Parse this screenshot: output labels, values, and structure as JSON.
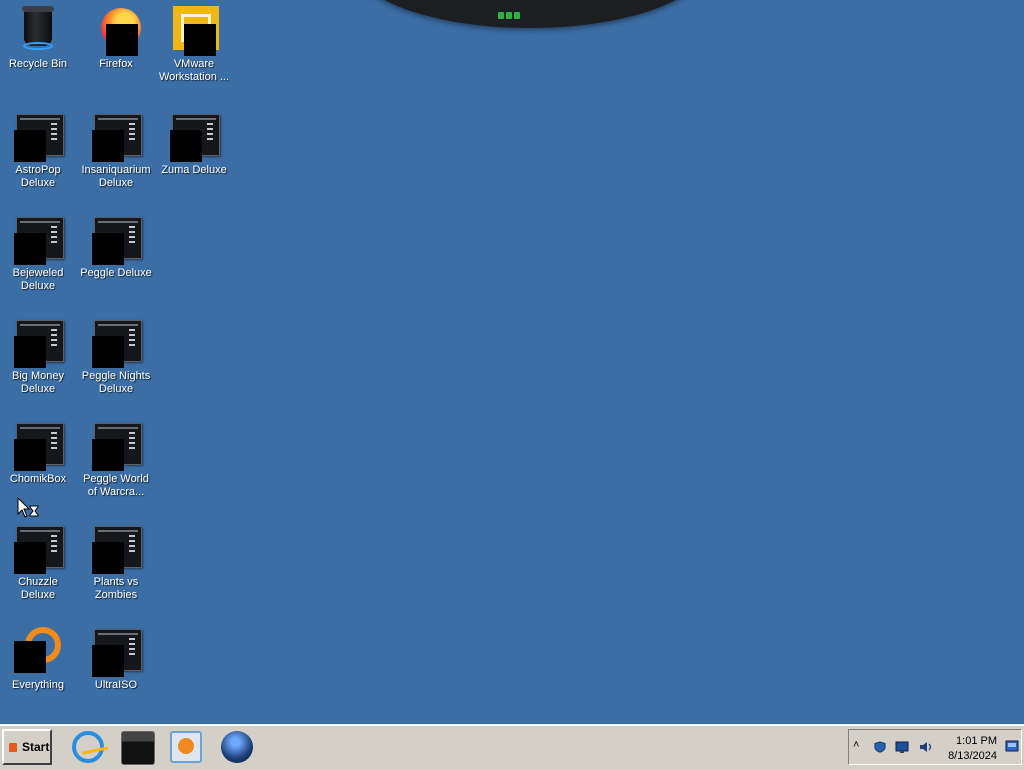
{
  "desktop": {
    "icons": [
      {
        "label": "Recycle Bin"
      },
      {
        "label": "Firefox"
      },
      {
        "label": "VMware Workstation ..."
      },
      {
        "label": "AstroPop Deluxe"
      },
      {
        "label": "Insaniquarium Deluxe"
      },
      {
        "label": "Zuma Deluxe"
      },
      {
        "label": "Bejeweled Deluxe"
      },
      {
        "label": "Peggle Deluxe"
      },
      {
        "label": "Big Money Deluxe"
      },
      {
        "label": "Peggle Nights Deluxe"
      },
      {
        "label": "ChomikBox"
      },
      {
        "label": "Peggle World of Warcra..."
      },
      {
        "label": "Chuzzle Deluxe"
      },
      {
        "label": "Plants vs Zombies"
      },
      {
        "label": "Everything"
      },
      {
        "label": "UltraISO"
      }
    ]
  },
  "taskbar": {
    "start_label": "Start",
    "quick_launch": [
      "internet-explorer-icon",
      "media-box-icon",
      "media-player-icon",
      "globe-icon"
    ],
    "tray": {
      "icons": [
        "show-hidden-icons-chevron",
        "security-shield-icon",
        "network-monitor-icon",
        "volume-icon",
        "show-desktop-icon"
      ],
      "time": "1:01 PM",
      "date": "8/13/2024"
    }
  },
  "colors": {
    "desktop_background": "#3c6ea6",
    "taskbar": "#d4d0c8",
    "tray_led": "#2bb34a"
  }
}
